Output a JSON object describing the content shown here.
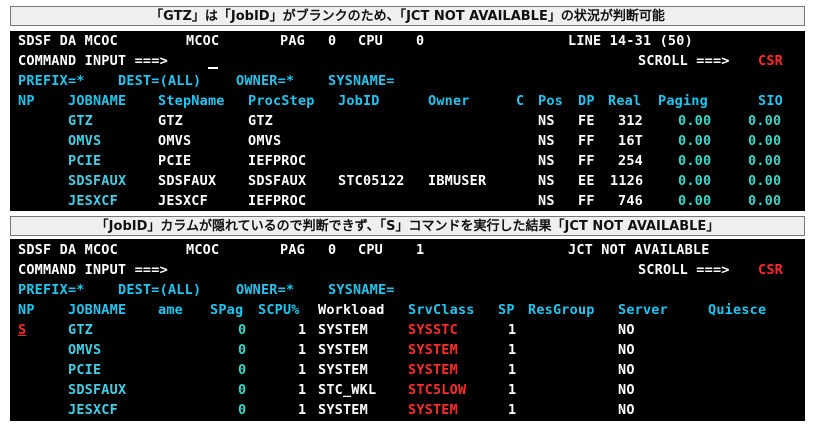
{
  "caption1": "「GTZ」は「JobID」がブランクのため、「JCT NOT AVAILABLE」の状況が判断可能",
  "caption2": "「JobID」カラムが隠れているので判断できず、「S」コマンドを実行した結果「JCT NOT AVAILABLE」",
  "top": {
    "l1": [
      "SDSF DA MCOC",
      "MCOC",
      "PAG",
      "0",
      "CPU",
      "0",
      "LINE 14-31 (50)"
    ],
    "l2": [
      "COMMAND INPUT ===>",
      "SCROLL ===>",
      "CSR"
    ],
    "l3": [
      "PREFIX=*",
      "DEST=(ALL)",
      "OWNER=*",
      "SYSNAME="
    ],
    "headers": [
      "NP",
      "JOBNAME",
      "StepName",
      "ProcStep",
      "JobID",
      "Owner",
      "C",
      "Pos",
      "DP",
      "Real",
      "Paging",
      "SIO"
    ],
    "rows": [
      [
        "GTZ",
        "GTZ",
        "GTZ",
        "",
        "",
        "NS",
        "FE",
        "312",
        "0.00",
        "0.00"
      ],
      [
        "OMVS",
        "OMVS",
        "OMVS",
        "",
        "",
        "NS",
        "FF",
        "16T",
        "0.00",
        "0.00"
      ],
      [
        "PCIE",
        "PCIE",
        "IEFPROC",
        "",
        "",
        "NS",
        "FF",
        "254",
        "0.00",
        "0.00"
      ],
      [
        "SDSFAUX",
        "SDSFAUX",
        "SDSFAUX",
        "STC05122",
        "IBMUSER",
        "NS",
        "EE",
        "1126",
        "0.00",
        "0.00"
      ],
      [
        "JESXCF",
        "JESXCF",
        "IEFPROC",
        "",
        "",
        "NS",
        "FF",
        "746",
        "0.00",
        "0.00"
      ]
    ]
  },
  "bottom": {
    "l1": [
      "SDSF DA MCOC",
      "MCOC",
      "PAG",
      "0",
      "CPU",
      "1",
      "JCT NOT AVAILABLE"
    ],
    "l2": [
      "COMMAND INPUT ===>",
      "SCROLL ===>",
      "CSR"
    ],
    "l3": [
      "PREFIX=*",
      "DEST=(ALL)",
      "OWNER=*",
      "SYSNAME="
    ],
    "headers": [
      "NP",
      "JOBNAME",
      "ame",
      "SPag",
      "SCPU%",
      "Workload",
      "SrvClass",
      "SP",
      "ResGroup",
      "Server",
      "Quiesce"
    ],
    "rows": [
      [
        "S",
        "GTZ",
        "0",
        "1",
        "SYSTEM",
        "SYSSTC",
        "1",
        "NO"
      ],
      [
        "",
        "OMVS",
        "0",
        "1",
        "SYSTEM",
        "SYSTEM",
        "1",
        "NO"
      ],
      [
        "",
        "PCIE",
        "0",
        "1",
        "SYSTEM",
        "SYSTEM",
        "1",
        "NO"
      ],
      [
        "",
        "SDSFAUX",
        "0",
        "1",
        "STC_WKL",
        "STC5LOW",
        "1",
        "NO"
      ],
      [
        "",
        "JESXCF",
        "0",
        "1",
        "SYSTEM",
        "SYSTEM",
        "1",
        "NO"
      ]
    ]
  },
  "colors": {
    "text": "#ffffff",
    "field": "#1fc6f0",
    "numeric": "#38d8c8",
    "alert": "#ff2a2a"
  }
}
